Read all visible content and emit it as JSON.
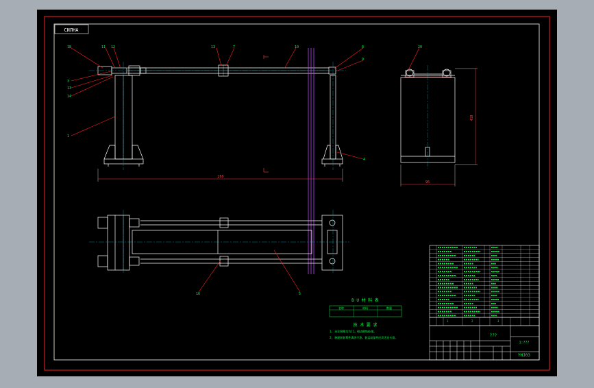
{
  "app": {
    "theme": {
      "background": "#a7adb5",
      "sheet": "#000000",
      "frame": "#ff2020",
      "border": "#ffffff",
      "geometry": "#ffffff",
      "leader": "#ff2020",
      "centerline": "#00e5ff",
      "axis": "#c040ff",
      "title_text": "#00ff40",
      "dimension": "#ff4040"
    }
  },
  "drawing": {
    "stamp": "СИЛНА",
    "dimensions": {
      "overall_length": "260",
      "side_height": "410",
      "side_width": "96"
    },
    "callouts": [
      "18",
      "11",
      "12",
      "13",
      "7",
      "10",
      "8",
      "9",
      "3",
      "13",
      "1",
      "14",
      "4",
      "5",
      "20",
      "16"
    ],
    "spec_table": {
      "title": "B U 材 料 表",
      "headers": [
        "名称",
        "材料",
        "数量"
      ]
    },
    "notes": {
      "title": "技 术 要 求",
      "lines": [
        "1. 未注倒角均为C1，锐边倒钝处理。",
        "2. 装配前各零件清洗干净，各运动部件应灵活无卡滞。"
      ]
    },
    "title_block": {
      "part_name": "???",
      "scale": "1:???",
      "drawing_no": "YHJ03",
      "grid_labels": [
        "1",
        "2",
        "3"
      ]
    }
  }
}
